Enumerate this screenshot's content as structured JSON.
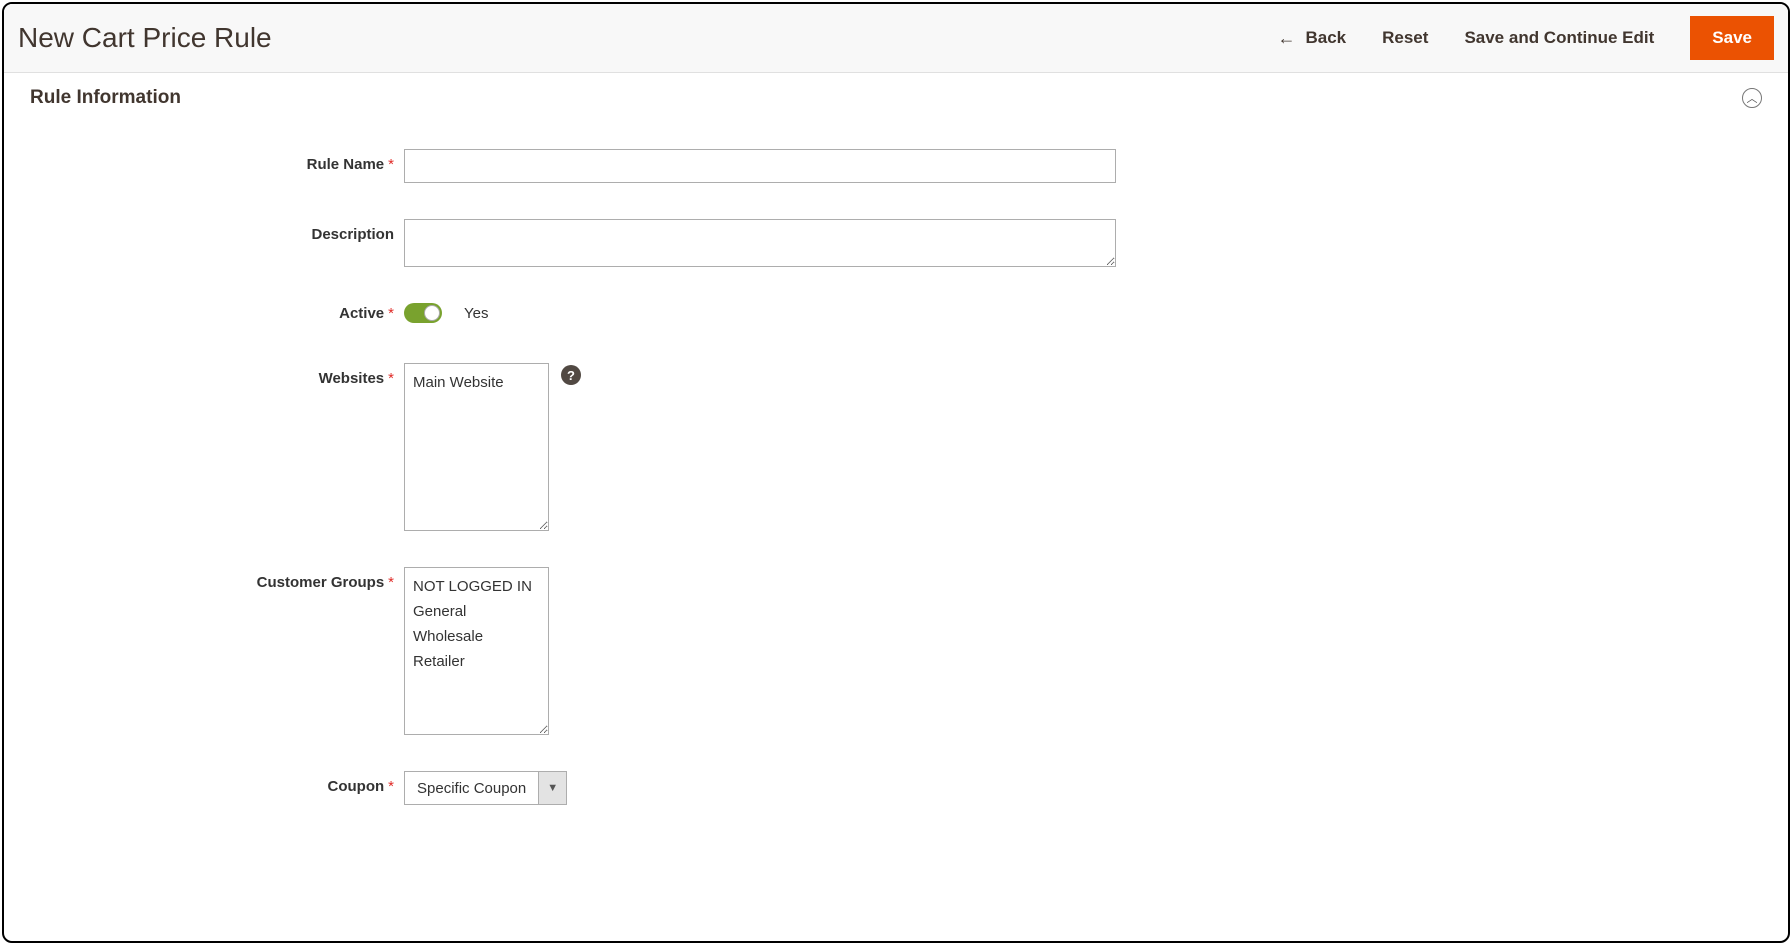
{
  "header": {
    "title": "New Cart Price Rule",
    "actions": {
      "back": "Back",
      "reset": "Reset",
      "save_continue": "Save and Continue Edit",
      "save": "Save"
    }
  },
  "section": {
    "title": "Rule Information"
  },
  "fields": {
    "rule_name": {
      "label": "Rule Name",
      "value": ""
    },
    "description": {
      "label": "Description",
      "value": ""
    },
    "active": {
      "label": "Active",
      "value_label": "Yes"
    },
    "websites": {
      "label": "Websites",
      "options": [
        "Main Website"
      ]
    },
    "customer_groups": {
      "label": "Customer Groups",
      "options": [
        "NOT LOGGED IN",
        "General",
        "Wholesale",
        "Retailer"
      ]
    },
    "coupon": {
      "label": "Coupon",
      "selected": "Specific Coupon"
    }
  }
}
